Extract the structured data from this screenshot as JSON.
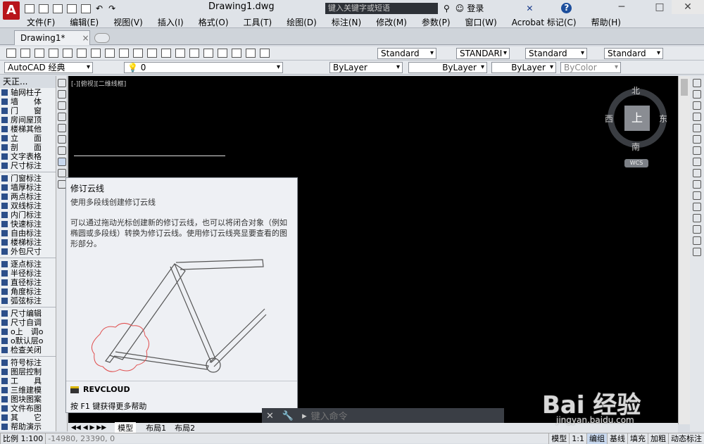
{
  "app": {
    "logo_letter": "A",
    "doc_title": "Drawing1.dwg",
    "search_placeholder": "键入关键字或短语",
    "login": "登录",
    "help_icon": "?"
  },
  "menus": [
    "文件(F)",
    "编辑(E)",
    "视图(V)",
    "插入(I)",
    "格式(O)",
    "工具(T)",
    "绘图(D)",
    "标注(N)",
    "修改(M)",
    "参数(P)",
    "窗口(W)",
    "Acrobat 标记(C)",
    "帮助(H)"
  ],
  "doc_tab": {
    "label": "Drawing1*",
    "close": "×"
  },
  "toolbar1": {
    "text_style": "Standard",
    "dim_style": "STANDARI",
    "table_style": "Standard",
    "multileader_style": "Standard"
  },
  "toolbar2": {
    "workspace": "AutoCAD 经典",
    "layer": "0",
    "color": "ByLayer",
    "linetype": "ByLayer",
    "lineweight": "ByLayer",
    "plotstyle": "ByColor"
  },
  "palette": {
    "header": "天正...",
    "groups": [
      [
        "轴网柱子",
        "墙　　体",
        "门　　窗",
        "房间屋顶",
        "楼梯其他",
        "立　　面",
        "剖　　面",
        "文字表格",
        "尺寸标注"
      ],
      [
        "门窗标注",
        "墙厚标注",
        "两点标注",
        "双线标注",
        "内门标注",
        "快速标注",
        "自由标注",
        "楼梯标注",
        "外包尺寸"
      ],
      [
        "逐点标注",
        "半径标注",
        "直径标注",
        "角度标注",
        "弧弦标注"
      ],
      [
        "尺寸编辑",
        "尺寸自调",
        "o上　调o",
        "o默认层o",
        "检查关闭"
      ],
      [
        "符号标注",
        "图层控制",
        "工　　具",
        "三维建模",
        "图块图案",
        "文件布图",
        "其　　它",
        "帮助演示"
      ]
    ]
  },
  "viewport_label": "[-][俯视][二维线框]",
  "viewcube": {
    "north": "北",
    "south": "南",
    "west": "西",
    "east": "东",
    "top": "上",
    "wcs": "WCS"
  },
  "tooltip": {
    "title": "修订云线",
    "summary": "使用多段线创建修订云线",
    "description": "可以通过拖动光标创建新的修订云线，也可以将闭合对象（例如椭圆或多段线）转换为修订云线。使用修订云线亮显要查看的图形部分。",
    "command": "REVCLOUD",
    "help": "按 F1 键获得更多帮助"
  },
  "command_line": {
    "placeholder": "键入命令"
  },
  "layout_tabs": [
    "模型",
    "布局1",
    "布局2"
  ],
  "status_bar": {
    "scale": "比例 1:100",
    "coords": "-14980, 23390, 0",
    "model": "模型",
    "annot_scale": "1:1",
    "toggles": [
      "编组",
      "基线",
      "填充",
      "加粗",
      "动态标注"
    ]
  },
  "watermark": {
    "text": "Bai 经验",
    "url": "jingyan.baidu.com"
  }
}
